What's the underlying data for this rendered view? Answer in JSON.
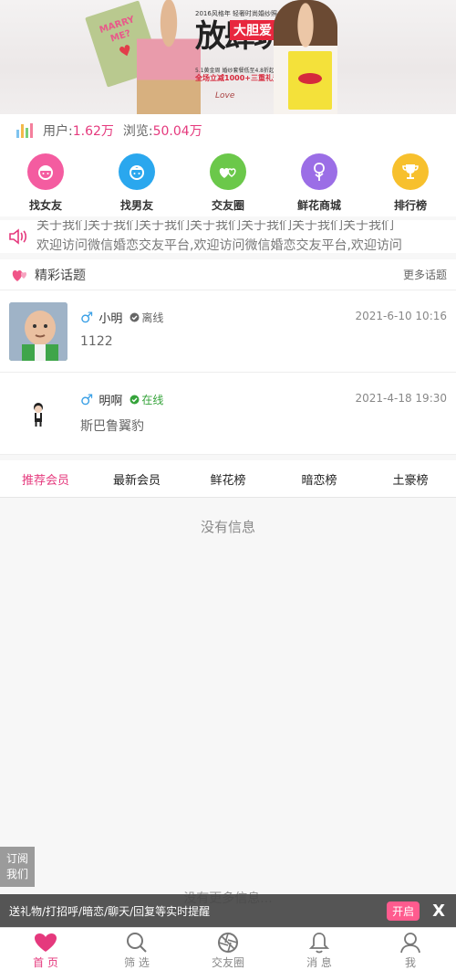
{
  "banner": {
    "sign_text": "MARRY ME?",
    "top_text": "2016风格年 轻奢时尚婚纱照",
    "big_text": "放肆玩",
    "tag_text": "大胆爱",
    "line1": "5.1黄金周 婚纱套餐低至4.8折起",
    "line2": "全场立减1000+三重礼遇",
    "logo": "Love"
  },
  "stats": {
    "users_label": "用户:",
    "users_value": "1.62万",
    "views_label": "浏览:",
    "views_value": "50.04万"
  },
  "menu": [
    {
      "label": "找女友",
      "icon": "girl-face-icon",
      "color": "#f45ca0"
    },
    {
      "label": "找男友",
      "icon": "boy-face-icon",
      "color": "#2aa7ee"
    },
    {
      "label": "交友圈",
      "icon": "hearts-icon",
      "color": "#6bc84a"
    },
    {
      "label": "鲜花商城",
      "icon": "rose-icon",
      "color": "#9b6ee6"
    },
    {
      "label": "排行榜",
      "icon": "trophy-icon",
      "color": "#f7c02d"
    }
  ],
  "notice": {
    "line1": "关于我们关于我们关于我们关于我们关于我们关于我们关于我们",
    "line2": "欢迎访问微信婚恋交友平台,欢迎访问微信婚恋交友平台,欢迎访问"
  },
  "topics": {
    "title": "精彩话题",
    "more": "更多话题",
    "posts": [
      {
        "name": "小明",
        "sex": "♂",
        "status": "离线",
        "status_color": "#666666",
        "content": "1122",
        "time": "2021-6-10 10:16"
      },
      {
        "name": "明啊",
        "sex": "♂",
        "status": "在线",
        "status_color": "#35a33a",
        "content": "斯巴鲁翼豹",
        "time": "2021-4-18 19:30"
      }
    ]
  },
  "tabs": [
    "推荐会员",
    "最新会员",
    "鲜花榜",
    "暗恋榜",
    "土豪榜"
  ],
  "empty_text": "没有信息",
  "nomore_text": "没有更多信息...",
  "subscribe": {
    "line1": "订阅",
    "line2": "我们"
  },
  "promo": {
    "message": "送礼物/打招呼/暗恋/聊天/回复等实时提醒",
    "open_label": "开启",
    "close_label": "X"
  },
  "tabbar": [
    {
      "label": "首 页",
      "icon": "heart-icon",
      "active": true
    },
    {
      "label": "筛 选",
      "icon": "search-icon",
      "active": false
    },
    {
      "label": "交友圈",
      "icon": "aperture-icon",
      "active": false
    },
    {
      "label": "消 息",
      "icon": "bell-icon",
      "active": false
    },
    {
      "label": "我",
      "icon": "user-icon",
      "active": false
    }
  ],
  "accent_color": "#e5397d"
}
